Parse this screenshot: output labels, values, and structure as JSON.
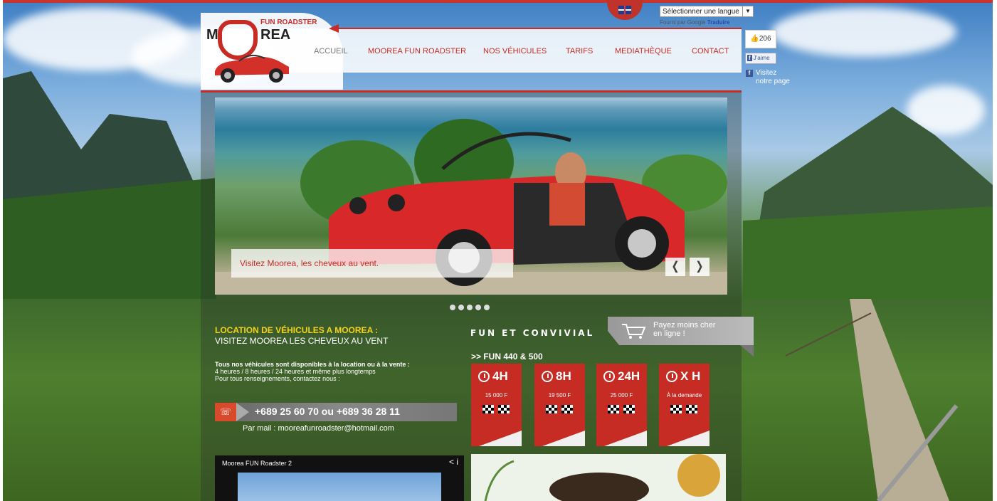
{
  "language": {
    "select_label": "Sélectionner une langue",
    "powered_by": "Fourni par",
    "translate_brand": "Google",
    "translate_link": "Traduire",
    "flag_icon": "uk-flag-icon"
  },
  "logo": {
    "m": "M",
    "rea": "REA",
    "subtitle": "FUN ROADSTER"
  },
  "nav": [
    {
      "label": "ACCUEIL",
      "color": "#777777"
    },
    {
      "label": "MOOREA FUN ROADSTER",
      "color": "#c62b24"
    },
    {
      "label": "NOS VÉHICULES",
      "color": "#c62b24"
    },
    {
      "label": "TARIFS",
      "color": "#c62b24"
    },
    {
      "label": "MEDIATHÈQUE",
      "color": "#c62b24"
    },
    {
      "label": "CONTACT",
      "color": "#c62b24"
    }
  ],
  "facebook": {
    "count": "206",
    "like_label": "J'aime",
    "like_icon": "f",
    "visit_line1": "Visitez",
    "visit_line2": "notre page"
  },
  "slider": {
    "caption": "Visitez Moorea, les cheveux au vent.",
    "prev": "❬",
    "next": "❭",
    "dot_count": 5
  },
  "location": {
    "title": "LOCATION DE VÉHICULES A MOOREA :",
    "subtitle": "VISITEZ MOOREA LES CHEVEUX AU VENT",
    "info_bold": "Tous nos véhicules sont disponibles à la location ou à la vente :",
    "info_line2": "4 heures / 8 heures / 24 heures et même plus longtemps",
    "info_line3": "Pour tous renseignements, contactez nous :",
    "phone": "+689 25 60 70 ou +689 36 28 11",
    "mail": "Par mail : mooreafunroadster@hotmail.com"
  },
  "fun": {
    "title": "FUN ET CONVIVIAL",
    "pay_line1": "Payez moins cher",
    "pay_line2": "en ligne !",
    "model": ">> FUN 440 & 500"
  },
  "pricing": [
    {
      "duration": "4H",
      "price": "15 000 F"
    },
    {
      "duration": "8H",
      "price": "19 500 F"
    },
    {
      "duration": "24H",
      "price": "25 000 F"
    },
    {
      "duration": "X H",
      "price": "À la demande"
    }
  ],
  "video": {
    "title": "Moorea FUN Roadster 2",
    "share_icon": "<",
    "info_icon": "i"
  },
  "colors": {
    "accent": "#c62b24",
    "title_yellow": "#f4d21c"
  }
}
